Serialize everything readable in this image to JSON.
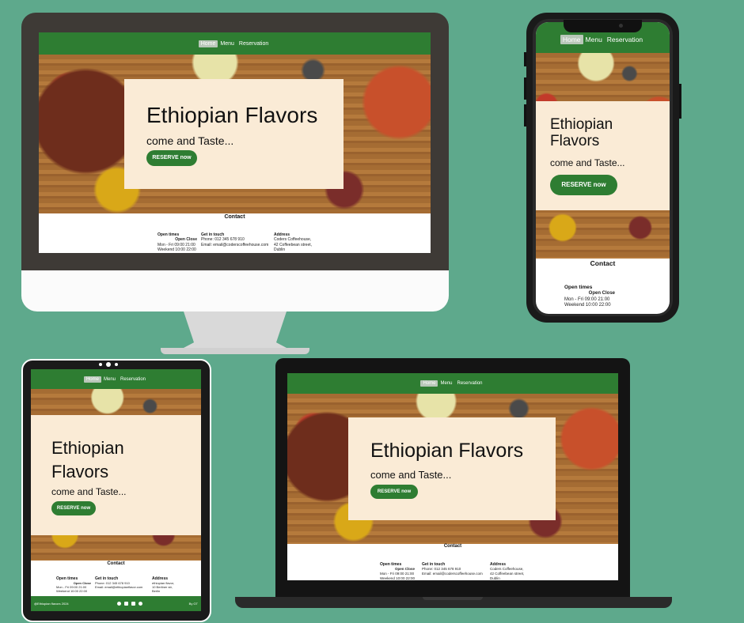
{
  "site": {
    "nav": [
      "Home",
      "Menu",
      "Reservation"
    ],
    "hero_title": "Ethiopian Flavors",
    "hero_title_line1": "Ethiopian",
    "hero_title_line2": "Flavors",
    "hero_subtitle": "come and Taste...",
    "cta": "RESERVE now",
    "contact_title": "Contact",
    "open_times": {
      "heading": "Open times",
      "cols": "Open Close",
      "row1": "Mon - Fri 09:00 21:00",
      "row2": "Weekend 10:00 22:00"
    },
    "get_in_touch_coders": {
      "heading": "Get in touch",
      "phone": "Phone: 012 345 678 910",
      "email": "Email: email@coderscoffeehouse.com"
    },
    "get_in_touch_tablet": {
      "heading": "Get in touch",
      "phone": "Phone: 012 345 678 910",
      "email": "Email: email@ethiopianflavor.com"
    },
    "address_coders": {
      "heading": "Address",
      "line1": "Coders Coffeehouse,",
      "line2": "42 Coffeebean street,",
      "line3": "Dublin"
    },
    "address_tablet": {
      "heading": "Address",
      "line1": "ethiopian flavor,",
      "line2": "10 Berliner str,",
      "line3": "Berlin"
    },
    "footer_left": "@Ethiopian flavors 2024",
    "footer_right": "By GT"
  },
  "colors": {
    "background": "#5ea98c",
    "nav_green": "#2e7d32",
    "hero_card": "#faebd6"
  },
  "icons": [
    "facebook-icon",
    "youtube-icon",
    "instagram-icon",
    "twitter-icon"
  ]
}
